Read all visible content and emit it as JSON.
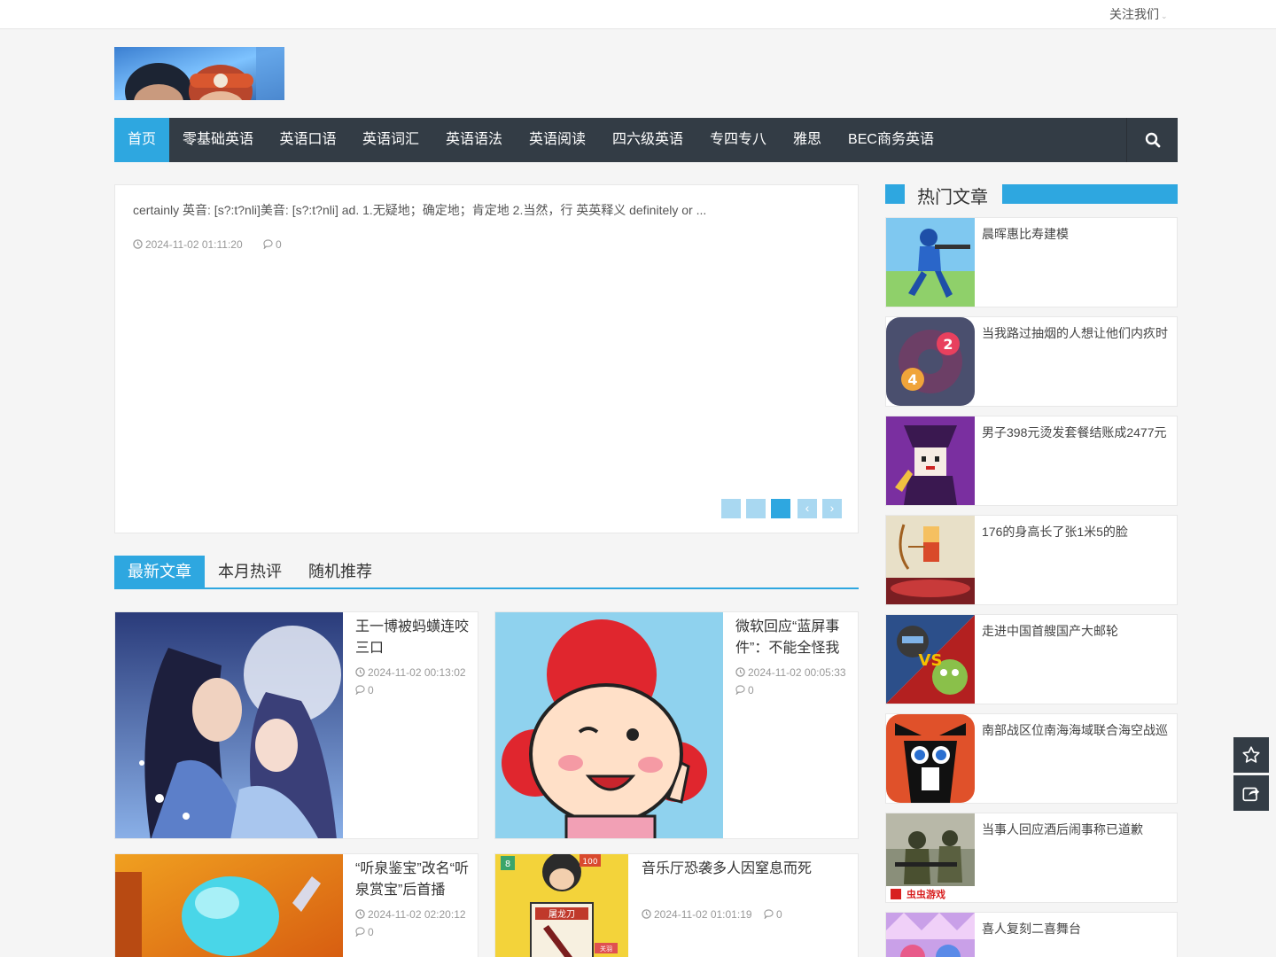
{
  "topbar": {
    "follow_label": "关注我们"
  },
  "nav": {
    "items": [
      "首页",
      "零基础英语",
      "英语口语",
      "英语词汇",
      "英语语法",
      "英语阅读",
      "四六级英语",
      "专四专八",
      "雅思",
      "BEC商务英语"
    ],
    "active_index": 0
  },
  "slider": {
    "excerpt": "certainly 英音: [s?:t?nli]美音: [s?:t?nli]   ad. 1.无疑地；确定地；肯定地 2.当然，行 英英释义 definitely or ...",
    "date": "2024-11-02 01:11:20",
    "comments": "0",
    "active_dot": 2,
    "dot_count": 3
  },
  "tabs": [
    "最新文章",
    "本月热评",
    "随机推荐"
  ],
  "articles": [
    {
      "title": "王一博被蚂蟥连咬三口",
      "date": "2024-11-02 00:13:02",
      "comments": "0"
    },
    {
      "title": "微软回应“蓝屏事件”：不能全怪我",
      "date": "2024-11-02 00:05:33",
      "comments": "0"
    },
    {
      "title": "“听泉鉴宝”改名“听泉赏宝”后首播",
      "date": "2024-11-02 02:20:12",
      "comments": "0"
    },
    {
      "title": "音乐厅恐袭多人因窒息而死",
      "date": "2024-11-02 01:01:19",
      "comments": "0"
    }
  ],
  "hot": {
    "title": "热门文章",
    "items": [
      "晨晖惠比寿建模",
      "当我路过抽烟的人想让他们内疚时",
      "男子398元烫发套餐结账成2477元",
      "176的身高长了张1米5的脸",
      "走进中国首艘国产大邮轮",
      "南部战区位南海海域联合海空战巡",
      "当事人回应酒后闹事称已道歉",
      "喜人复刻二喜舞台"
    ]
  },
  "thumb_labels": {
    "badge_8": "8",
    "badge_100": "100",
    "card_text": "屠龙刀",
    "small_label": "关羽",
    "hot_badge_2": "2",
    "hot_badge_4": "4",
    "game_brand": "虫虫游戏",
    "vs": "VS"
  },
  "colors": {
    "accent": "#2ea7e0",
    "nav_bg": "#333c45",
    "dot_inactive": "#a9d8f1"
  }
}
